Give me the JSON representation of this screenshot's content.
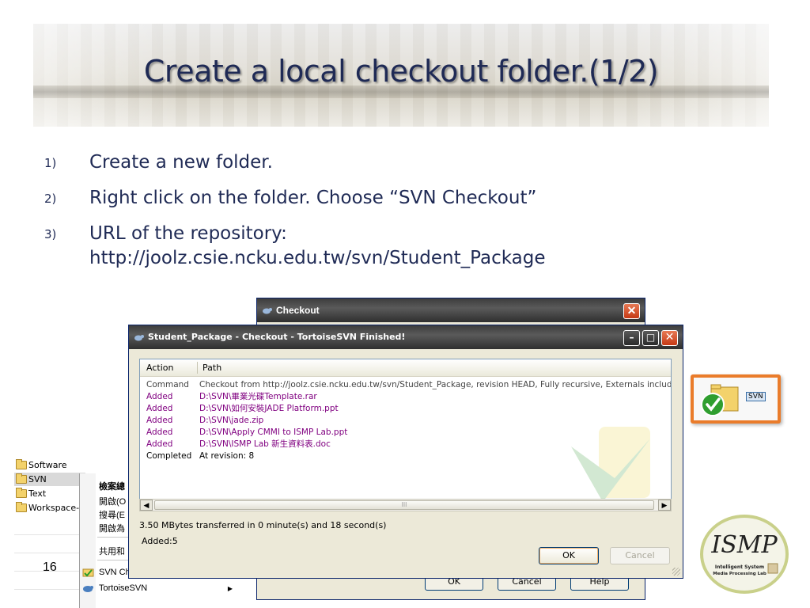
{
  "slide": {
    "title": "Create a local checkout folder.(1/2)",
    "page_number": "16",
    "bullets": [
      {
        "num": "1)",
        "text": "Create a new folder."
      },
      {
        "num": "2)",
        "text": "Right click on the folder. Choose “SVN Checkout”"
      },
      {
        "num": "3)",
        "text": "URL of the repository:",
        "text2": "http://joolz.csie.ncku.edu.tw/svn/Student_Package"
      }
    ]
  },
  "explorer": {
    "folders": [
      "Software",
      "SVN",
      "Text",
      "Workspace-"
    ]
  },
  "context_menu": {
    "items": [
      "檢案總",
      "開啟(O",
      "搜尋(E",
      "開啟為",
      "共用和",
      "SVN Ch",
      "TortoiseSVN"
    ]
  },
  "checkout_dialog": {
    "title": "Checkout",
    "buttons": [
      "OK",
      "Cancel",
      "Help"
    ]
  },
  "progress_dialog": {
    "title": "Student_Package - Checkout - TortoiseSVN Finished!",
    "columns": [
      "Action",
      "Path"
    ],
    "rows": [
      {
        "action": "Command",
        "path": "Checkout from http://joolz.csie.ncku.edu.tw/svn/Student_Package, revision HEAD, Fully recursive, Externals include",
        "color": "#444444"
      },
      {
        "action": "Added",
        "path": "D:\\SVN\\畢業光碟Template.rar",
        "color": "#800080"
      },
      {
        "action": "Added",
        "path": "D:\\SVN\\如何安裝JADE Platform.ppt",
        "color": "#800080"
      },
      {
        "action": "Added",
        "path": "D:\\SVN\\jade.zip",
        "color": "#800080"
      },
      {
        "action": "Added",
        "path": "D:\\SVN\\Apply CMMI to ISMP Lab.ppt",
        "color": "#800080"
      },
      {
        "action": "Added",
        "path": "D:\\SVN\\ISMP Lab 新生資料表.doc",
        "color": "#800080"
      },
      {
        "action": "Completed",
        "path": "At revision: 8",
        "color": "#000000"
      }
    ],
    "scroll_thumb_label": "III",
    "status_transfer": "3.50 MBytes transferred in 0 minute(s) and 18 second(s)",
    "status_added": "Added:5",
    "ok_label": "OK",
    "cancel_label": "Cancel"
  },
  "svn_thumbnail": {
    "label": "SVN"
  },
  "logo": {
    "text": "ISMP",
    "subtitle1": "Intelligent System",
    "subtitle2": "Media Processing Lab"
  },
  "colors": {
    "title_text": "#1f2a55",
    "body_text": "#1f2a55",
    "added_row": "#800080",
    "thumb_frame": "#ea7c2b"
  }
}
